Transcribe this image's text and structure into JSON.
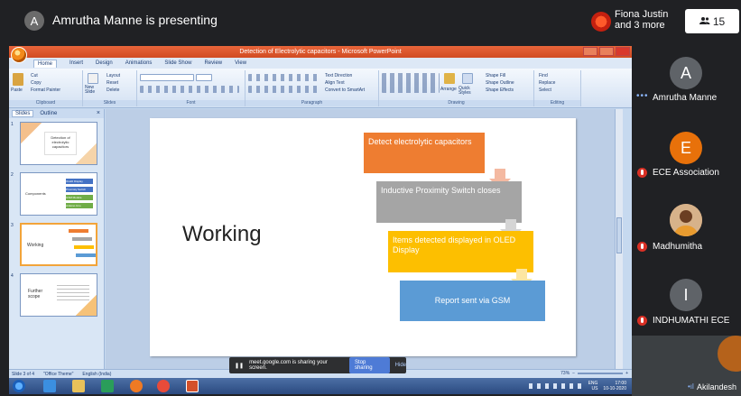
{
  "meet": {
    "presenter_initial": "A",
    "presenting_text": "Amrutha Manne is presenting",
    "others_text_line1": "Fiona Justin",
    "others_text_line2": "and 3 more",
    "people_count": "15",
    "participants": [
      {
        "initial": "A",
        "name": "Amrutha Manne",
        "color": "#5f6368",
        "muted": false
      },
      {
        "initial": "E",
        "name": "ECE Association",
        "color": "#e8710a",
        "muted": true
      },
      {
        "initial": "",
        "name": "Madhumitha",
        "color": "#c58b5d",
        "muted": true
      },
      {
        "initial": "I",
        "name": "INDHUMATHI ECE",
        "color": "#5f6368",
        "muted": true
      }
    ],
    "bottom_user": "Akilandesh",
    "share_banner": {
      "text": "meet.google.com is sharing your screen.",
      "stop_label": "Stop sharing",
      "hide_label": "Hide"
    }
  },
  "ppt": {
    "window_title": "Detection of Electrolytic capacitors - Microsoft PowerPoint",
    "ribbon_tabs": [
      "Home",
      "Insert",
      "Design",
      "Animations",
      "Slide Show",
      "Review",
      "View"
    ],
    "active_tab": "Home",
    "ribbon_groups": [
      "Clipboard",
      "Slides",
      "Font",
      "Paragraph",
      "Drawing",
      "Editing"
    ],
    "clipboard_buttons": [
      "Cut",
      "Copy",
      "Format Painter"
    ],
    "paste_label": "Paste",
    "slides_buttons": [
      "Layout",
      "Reset",
      "Delete"
    ],
    "new_slide_label": "New Slide",
    "paragraph_buttons": [
      "Text Direction",
      "Align Text",
      "Convert to SmartArt"
    ],
    "drawing_buttons": [
      "Shape Fill",
      "Shape Outline",
      "Shape Effects"
    ],
    "arrange_label": "Arrange",
    "quick_styles_label": "Quick Styles",
    "editing_buttons": [
      "Find",
      "Replace",
      "Select"
    ],
    "pane_tabs": [
      "Slides",
      "Outline"
    ],
    "thumbnails": [
      {
        "num": "1",
        "text": "Detection of electrolytic capacitors",
        "selected": false
      },
      {
        "num": "2",
        "text": "Components",
        "selected": false,
        "items": [
          "OLED Display",
          "Proximity Switch",
          "GSM Module",
          "Arduino Uno"
        ]
      },
      {
        "num": "3",
        "text": "Working",
        "selected": true
      },
      {
        "num": "4",
        "text": "Further scope",
        "selected": false
      }
    ],
    "slide": {
      "title": "Working",
      "steps": [
        {
          "text": "Detect electrolytic capacitors",
          "color": "#ee7d31"
        },
        {
          "text": "Inductive Proximity Switch closes",
          "color": "#a5a5a5"
        },
        {
          "text": "Items detected displayed in OLED Display",
          "color": "#fdbf00"
        },
        {
          "text": "Report sent via GSM",
          "color": "#5b9bd5"
        }
      ]
    },
    "status": {
      "slide_of": "Slide 3 of 4",
      "theme": "\"Office Theme\"",
      "language": "English (India)",
      "zoom": "73%"
    },
    "tray": {
      "lang": "ENG",
      "region": "US",
      "time": "17:00",
      "date": "10-10-2020"
    }
  }
}
